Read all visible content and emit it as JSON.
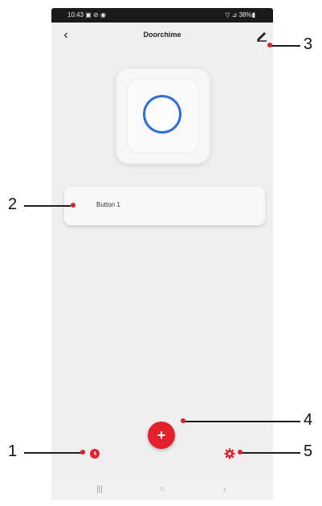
{
  "status_bar": {
    "time_and_icons": "10:43 ▣ ⊘ ◉",
    "right_icons": "▽ ⊿ 38%▮"
  },
  "app_bar": {
    "title": "Doorchime"
  },
  "buttons_list": [
    {
      "label": "Button 1"
    }
  ],
  "bottom_controls": {
    "add_label": "+"
  },
  "annotations": [
    {
      "number": "1"
    },
    {
      "number": "2"
    },
    {
      "number": "3"
    },
    {
      "number": "4"
    },
    {
      "number": "5"
    }
  ],
  "colors": {
    "accent": "#e3202c",
    "ring": "#2f6fd6",
    "background": "#efefef"
  },
  "icons": {
    "back": "chevron-left-icon",
    "edit": "pencil-icon",
    "history": "clock-icon",
    "settings": "gear-icon",
    "recent_apps": "recent-apps-icon",
    "home": "home-circle-icon",
    "nav_back": "nav-back-icon"
  }
}
